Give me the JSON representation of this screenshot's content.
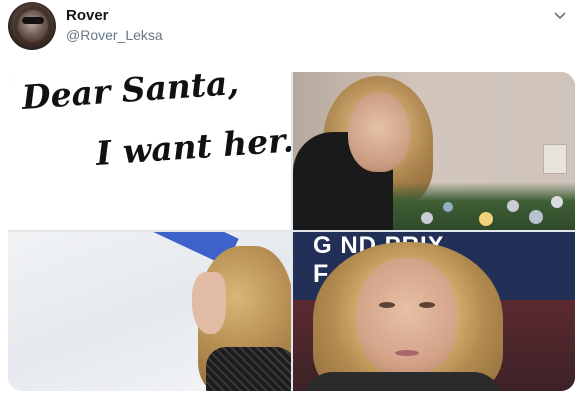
{
  "tweet": {
    "display_name": "Rover",
    "handle": "@Rover_Leksa",
    "menu_icon": "chevron-down-icon",
    "avatar_icon": "avatar"
  },
  "media": {
    "image1": {
      "line1": "Dear Santa,",
      "line2": "I want her."
    },
    "image4": {
      "banner_line1": "G  ND PRIX",
      "banner_line2": "F  SKATI"
    }
  },
  "colors": {
    "handle": "#657786",
    "name": "#14171a",
    "banner": "#223058"
  }
}
